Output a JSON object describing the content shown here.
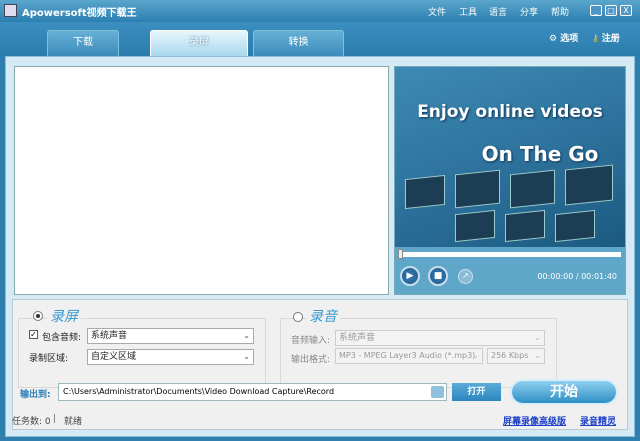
{
  "window": {
    "title": "Apowersoft视频下载王",
    "minimize": "_",
    "maximize": "□",
    "close": "X"
  },
  "menu": [
    "文件",
    "工具",
    "语言",
    "分享",
    "帮助"
  ],
  "tabs": [
    "下载",
    "录屏",
    "转换"
  ],
  "toolbar": {
    "options": "选项",
    "register": "注册"
  },
  "player": {
    "promo_line1": "Enjoy online videos",
    "promo_line2": "On The Go",
    "time": "00:00:00 / 00:01:40",
    "progress": 0
  },
  "screen_group": {
    "title": "录屏",
    "selected": true,
    "include_audio_label": "包含音频:",
    "include_audio_checked": true,
    "audio_source": "系统声音",
    "region_label": "录制区域:",
    "region": "自定义区域"
  },
  "audio_group": {
    "title": "录音",
    "selected": false,
    "input_label": "音频输入:",
    "input": "系统声音",
    "format_label": "输出格式:",
    "format": "MP3 - MPEG Layer3 Audio (*.mp3)",
    "bitrate": "256 Kbps"
  },
  "output": {
    "label": "输出到:",
    "path": "C:\\Users\\Administrator\\Documents\\Video Download Capture\\Record",
    "open": "打开",
    "start": "开始"
  },
  "status": {
    "tasks": "任务数: 0",
    "sep": "|",
    "state": "就绪",
    "link1": "屏幕录像高级版",
    "link2": "录音精灵"
  }
}
